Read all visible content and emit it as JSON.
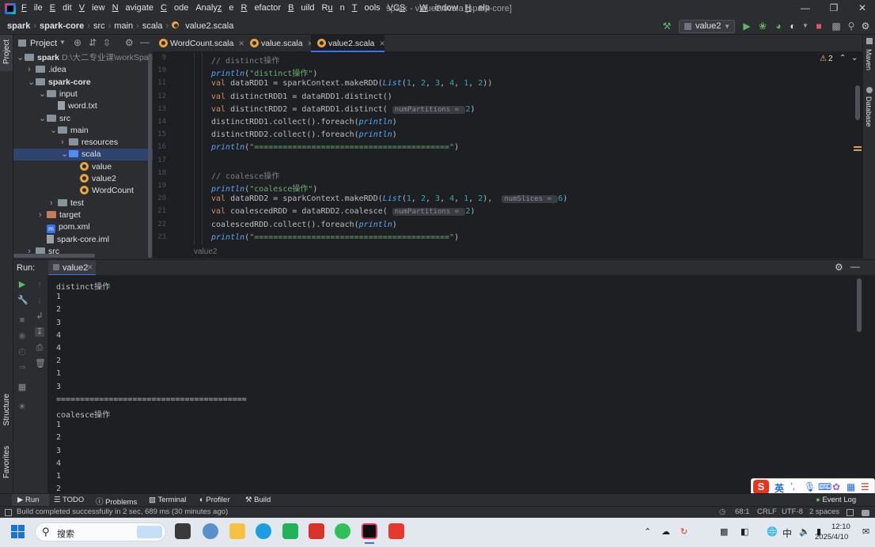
{
  "window": {
    "title": "spark - value2.scala [spark-core]",
    "menu": [
      "File",
      "Edit",
      "View",
      "Navigate",
      "Code",
      "Analyze",
      "Refactor",
      "Build",
      "Run",
      "Tools",
      "VCS",
      "Window",
      "Help"
    ],
    "mnemonics": [
      "F",
      "E",
      "V",
      "N",
      "C",
      "z",
      "R",
      "B",
      "u",
      "T",
      "S",
      "W",
      "H"
    ]
  },
  "breadcrumb": [
    "spark",
    "spark-core",
    "src",
    "main",
    "scala",
    "value2.scala"
  ],
  "toolbar": {
    "run_config": "value2"
  },
  "project_panel": {
    "title": "Project",
    "tree": [
      {
        "label": "spark",
        "extra": "D:\\大二专业课\\workSpace\\",
        "depth": 0,
        "chev": "v",
        "icon": "folder",
        "bold": true
      },
      {
        "label": ".idea",
        "depth": 1,
        "chev": ">",
        "icon": "folder"
      },
      {
        "label": "spark-core",
        "depth": 1,
        "chev": "v",
        "icon": "folder",
        "bold": true
      },
      {
        "label": "input",
        "depth": 2,
        "chev": "v",
        "icon": "folder"
      },
      {
        "label": "word.txt",
        "depth": 3,
        "chev": "",
        "icon": "file"
      },
      {
        "label": "src",
        "depth": 2,
        "chev": "v",
        "icon": "folder"
      },
      {
        "label": "main",
        "depth": 3,
        "chev": "v",
        "icon": "folder"
      },
      {
        "label": "resources",
        "depth": 4,
        "chev": ">",
        "icon": "folder"
      },
      {
        "label": "scala",
        "depth": 4,
        "chev": "v",
        "icon": "folder-blue",
        "selected": true
      },
      {
        "label": "value",
        "depth": 5,
        "chev": "",
        "icon": "scala"
      },
      {
        "label": "value2",
        "depth": 5,
        "chev": "",
        "icon": "scala"
      },
      {
        "label": "WordCount",
        "depth": 5,
        "chev": "",
        "icon": "scala"
      },
      {
        "label": "test",
        "depth": 3,
        "chev": ">",
        "icon": "folder"
      },
      {
        "label": "target",
        "depth": 2,
        "chev": ">",
        "icon": "folder-orange"
      },
      {
        "label": "pom.xml",
        "depth": 2,
        "chev": "",
        "icon": "maven"
      },
      {
        "label": "spark-core.iml",
        "depth": 2,
        "chev": "",
        "icon": "file"
      },
      {
        "label": "src",
        "depth": 1,
        "chev": ">",
        "icon": "folder"
      }
    ]
  },
  "editor": {
    "tabs": [
      {
        "label": "WordCount.scala",
        "active": false
      },
      {
        "label": "value.scala",
        "active": false
      },
      {
        "label": "value2.scala",
        "active": true
      }
    ],
    "warnings_count": "2",
    "lines": [
      {
        "n": "9",
        "html": "<span class=\"cmt\">// distinct操作</span>"
      },
      {
        "n": "10",
        "html": "<span class=\"it\">println</span>(<span class=\"str\">\"distinct操作\"</span>)"
      },
      {
        "n": "11",
        "html": "<span class=\"kw\">val</span> dataRDD1 = sparkContext.makeRDD(<span class=\"it\">List</span>(<span class=\"num\">1</span>, <span class=\"num\">2</span>, <span class=\"num\">3</span>, <span class=\"num\">4</span>, <span class=\"num\">1</span>, <span class=\"num\">2</span>))"
      },
      {
        "n": "12",
        "html": "<span class=\"kw\">val</span> distinctRDD1 = dataRDD1.distinct()"
      },
      {
        "n": "13",
        "html": "<span class=\"kw\">val</span> distinctRDD2 = dataRDD1.distinct( <span class=\"hint\">numPartitions = </span><span class=\"num\">2</span>)"
      },
      {
        "n": "14",
        "html": "distinctRDD1.collect().foreach(<span class=\"it\">println</span>)"
      },
      {
        "n": "15",
        "html": "distinctRDD2.collect().foreach(<span class=\"it\">println</span>)"
      },
      {
        "n": "16",
        "html": "<span class=\"it\">println</span>(<span class=\"str\">\"=========================================\"</span>)"
      },
      {
        "n": "17",
        "html": ""
      },
      {
        "n": "18",
        "html": "<span class=\"cmt\">// coalesce操作</span>"
      },
      {
        "n": "19",
        "html": "<span class=\"it\">println</span>(<span class=\"str\">\"coalesce操作\"</span>)"
      },
      {
        "n": "20",
        "html": "<span class=\"kw\">val</span> dataRDD2 = sparkContext.makeRDD(<span class=\"it\">List</span>(<span class=\"num\">1</span>, <span class=\"num\">2</span>, <span class=\"num\">3</span>, <span class=\"num\">4</span>, <span class=\"num\">1</span>, <span class=\"num\">2</span>),  <span class=\"hint\">numSlices = </span><span class=\"num\">6</span>)"
      },
      {
        "n": "21",
        "html": "<span class=\"kw\">val</span> coalescedRDD = dataRDD2.coalesce( <span class=\"hint\">numPartitions = </span><span class=\"num\">2</span>)"
      },
      {
        "n": "22",
        "html": "coalescedRDD.collect().foreach(<span class=\"it\">println</span>)"
      },
      {
        "n": "23",
        "html": "<span class=\"it\">println</span>(<span class=\"str\">\"=========================================\"</span>)"
      }
    ],
    "footer": "value2"
  },
  "right_tools": [
    "Maven",
    "Database"
  ],
  "left_tools": [
    "Project",
    "Structure",
    "Favorites"
  ],
  "run_panel": {
    "label": "Run:",
    "tab": "value2",
    "output": [
      "distinct操作",
      "1",
      "2",
      "3",
      "4",
      "4",
      "2",
      "1",
      "3",
      "========================================",
      "coalesce操作",
      "1",
      "2",
      "3",
      "4",
      "1",
      "2"
    ]
  },
  "bottom_tools": [
    "Run",
    "TODO",
    "Problems",
    "Terminal",
    "Profiler",
    "Build"
  ],
  "event_log": "Event Log",
  "status": {
    "message": "Build completed successfully in 2 sec, 689 ms (30 minutes ago)",
    "position": "68:1",
    "line_sep": "CRLF",
    "encoding": "UTF-8",
    "indent": "2 spaces"
  },
  "ime": {
    "lang": "英"
  },
  "taskbar": {
    "search": "搜索",
    "time": "12:10",
    "date": "2025/4/10",
    "lang": "中"
  }
}
